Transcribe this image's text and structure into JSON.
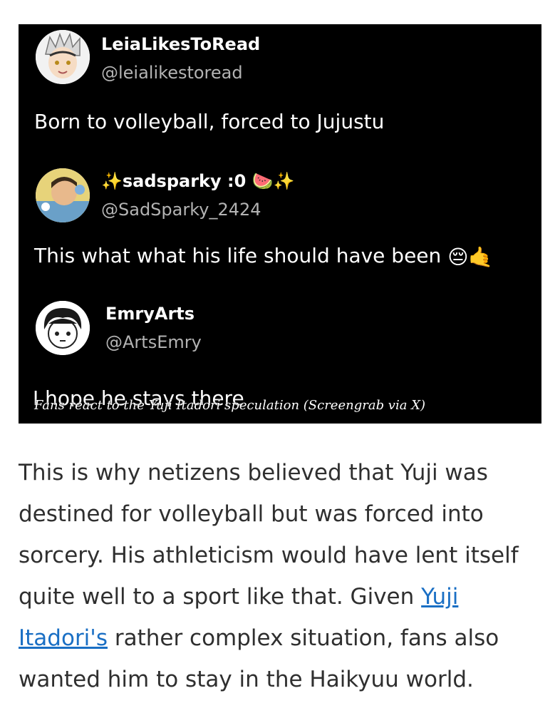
{
  "tweets": [
    {
      "name": "LeiaLikesToRead",
      "handle": "@leialikestoread",
      "text": "Born to volleyball, forced to Jujustu"
    },
    {
      "name_prefix": "✨",
      "name": "sadsparky :0",
      "name_suffix": "🍉✨",
      "handle": "@SadSparky_2424",
      "text": "This what what his life should have been",
      "text_emojis": "😔🤙"
    },
    {
      "name": "EmryArts",
      "handle": "@ArtsEmry",
      "text": "I hope he stays there"
    }
  ],
  "caption": "Fans react to the Yuji Itadori speculation (Screengrab via X)",
  "article": {
    "before_link": "This is why netizens believed that Yuji was destined for volleyball but was forced into sorcery. His athleticism would have lent itself quite well to a sport like that. Given ",
    "link_text": "Yuji Itadori's",
    "after_link": " rather complex situation, fans also wanted him to stay in the Haikyuu world."
  },
  "colors": {
    "screengrab_bg": "#000000",
    "handle": "#b3b3b3",
    "link": "#1a6fc4",
    "body_text": "#2f2f2f"
  }
}
